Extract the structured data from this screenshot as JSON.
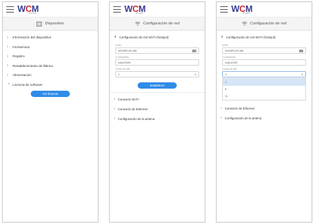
{
  "logo": {
    "w": "W",
    "c": "C",
    "m": "M",
    "sub": "PLUS"
  },
  "panel1": {
    "title": "Dispositivo",
    "items": [
      {
        "label": "Información del dispositivo"
      },
      {
        "label": "Fecha/Hora"
      },
      {
        "label": "Registro"
      },
      {
        "label": "Restablecimiento de fábrica"
      },
      {
        "label": "Alimentación"
      },
      {
        "label": "Licencia de software"
      }
    ],
    "button": "Ver licencia"
  },
  "panel2": {
    "title": "Configuración de red",
    "section": "Configuración de red Wi-Fi (hotspot)",
    "ssid_label": "SSID",
    "ssid_value": "WCMPLUS-d8c",
    "pass_label": "Contraseña",
    "pass_value": "cmp12345",
    "channel_label": "Canal de wifi",
    "channel_value": "1",
    "button": "Establecer",
    "sections": [
      {
        "label": "Conexión Wi-Fi"
      },
      {
        "label": "Conexión de Ethernet"
      },
      {
        "label": "Configuración de la antena"
      }
    ]
  },
  "panel3": {
    "title": "Configuración de red",
    "section": "Configuración de red Wi-Fi (hotspot)",
    "ssid_label": "SSID",
    "ssid_value": "WCMPLUS-d8c",
    "pass_label": "Contraseña",
    "pass_value": "cmp12345",
    "channel_label": "Canal de wifi",
    "channel_value": "1",
    "options": [
      "1",
      "6",
      "11"
    ],
    "sections": [
      {
        "label": "Conexión de Ethernet"
      },
      {
        "label": "Configuración de la antena"
      }
    ]
  },
  "colors": {
    "accent": "#2f8ce8",
    "logo_blue": "#3a3d92",
    "logo_red": "#d62d2d",
    "selected_option": "#d6e6f7"
  }
}
